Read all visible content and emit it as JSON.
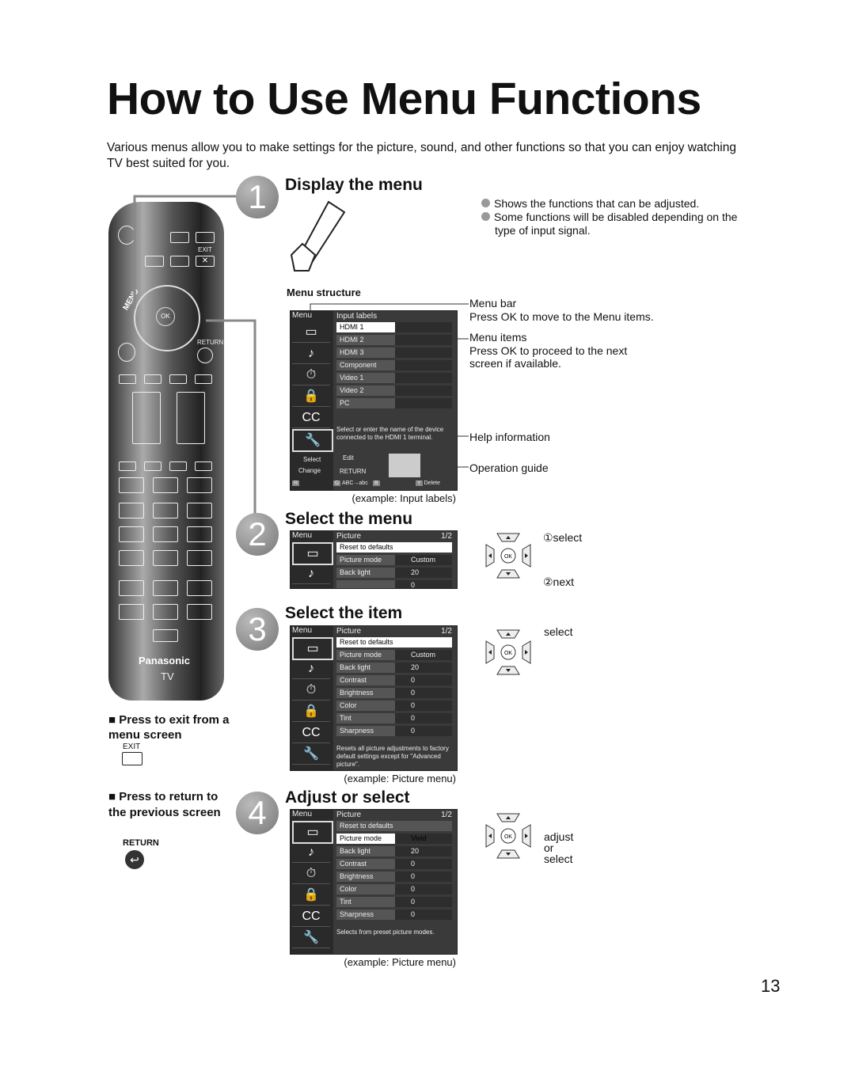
{
  "title": "How to Use Menu Functions",
  "intro": "Various menus allow you to make settings for the picture, sound, and other functions so that you can enjoy watching TV best suited for you.",
  "steps": [
    {
      "num": "1",
      "heading": "Display the menu"
    },
    {
      "num": "2",
      "heading": "Select the menu"
    },
    {
      "num": "3",
      "heading": "Select the item"
    },
    {
      "num": "4",
      "heading": "Adjust or select"
    }
  ],
  "step1_notes": [
    "Shows the functions that can be adjusted.",
    "Some functions will be disabled depending on the type of input signal."
  ],
  "menu_structure_label": "Menu structure",
  "callouts": {
    "menu_bar": "Menu bar",
    "menu_bar_desc": "Press OK to move to the Menu items.",
    "menu_items": "Menu items",
    "menu_items_desc": "Press OK to proceed to the next screen if available.",
    "help": "Help information",
    "guide": "Operation guide"
  },
  "remote": {
    "exit": "EXIT",
    "menu": "MENU",
    "ok": "OK",
    "return": "RETURN",
    "brand": "Panasonic",
    "tv": "TV"
  },
  "side_notes": {
    "exit_title": "Press to exit from a menu screen",
    "exit_key": "EXIT",
    "return_title": "Press to return to the previous screen",
    "return_key": "RETURN"
  },
  "screens": [
    {
      "menu": "Menu",
      "title": "Input labels",
      "page": "",
      "rows": [
        [
          "HDMI 1",
          ""
        ],
        [
          "HDMI 2",
          ""
        ],
        [
          "HDMI 3",
          ""
        ],
        [
          "Component",
          ""
        ],
        [
          "Video 1",
          ""
        ],
        [
          "Video 2",
          ""
        ],
        [
          "PC",
          ""
        ]
      ],
      "highlight": 0,
      "help": "Select or enter the name of the device connected to the HDMI 1 terminal.",
      "guide": {
        "select": "Select",
        "change": "Change",
        "edit": "Edit",
        "return": "RETURN",
        "r": "R",
        "g": "G",
        "abc": "ABC→abc",
        "b": "B",
        "y": "Y",
        "delete": "Delete"
      },
      "caption": "(example: Input labels)"
    },
    {
      "menu": "Menu",
      "title": "Picture",
      "page": "1/2",
      "rows": [
        [
          "Reset to defaults",
          ""
        ],
        [
          "Picture mode",
          "Custom"
        ],
        [
          "Back light",
          "20"
        ],
        [
          "",
          "0"
        ]
      ],
      "highlight": 0,
      "help": "",
      "caption": ""
    },
    {
      "menu": "Menu",
      "title": "Picture",
      "page": "1/2",
      "rows": [
        [
          "Reset to defaults",
          ""
        ],
        [
          "Picture mode",
          "Custom"
        ],
        [
          "Back light",
          "20"
        ],
        [
          "Contrast",
          "0"
        ],
        [
          "Brightness",
          "0"
        ],
        [
          "Color",
          "0"
        ],
        [
          "Tint",
          "0"
        ],
        [
          "Sharpness",
          "0"
        ]
      ],
      "highlight": 0,
      "help": "Resets all picture adjustments to factory default settings except for \"Advanced picture\".",
      "caption": "(example:  Picture menu)"
    },
    {
      "menu": "Menu",
      "title": "Picture",
      "page": "1/2",
      "rows": [
        [
          "Reset to defaults",
          ""
        ],
        [
          "Picture mode",
          "Vivid"
        ],
        [
          "Back light",
          "20"
        ],
        [
          "Contrast",
          "0"
        ],
        [
          "Brightness",
          "0"
        ],
        [
          "Color",
          "0"
        ],
        [
          "Tint",
          "0"
        ],
        [
          "Sharpness",
          "0"
        ]
      ],
      "highlight": 1,
      "help": "Selects from preset picture modes.",
      "caption": "(example:  Picture menu)"
    }
  ],
  "side_icons": [
    "picture-icon",
    "sound-icon",
    "timer-icon",
    "lock-icon",
    "cc-icon",
    "setup-icon"
  ],
  "pad_labels": {
    "select1": "①select",
    "next": "②next",
    "select": "select",
    "adjust": "adjust",
    "or": "or",
    "select2": "select"
  },
  "page_number": "13"
}
